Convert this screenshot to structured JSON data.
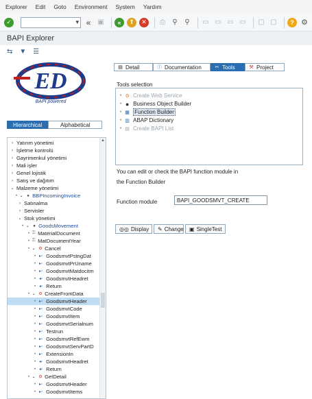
{
  "menu": [
    "Explorer",
    "Edit",
    "Goto",
    "Environment",
    "System",
    "Yardım"
  ],
  "title": "BAPI Explorer",
  "logo_text": "BAPI powered",
  "left_tabs": [
    "Hierarchical",
    "Alphabetical"
  ],
  "tree": [
    {
      "label": "Yatırım yönetimi",
      "indent": 0,
      "icon": "chevron-right-icon",
      "sel": false,
      "blue": false
    },
    {
      "label": "İşletme kontrolü",
      "indent": 0,
      "icon": "chevron-right-icon",
      "sel": false,
      "blue": false
    },
    {
      "label": "Gayrimenkul yönetimi",
      "indent": 0,
      "icon": "chevron-right-icon",
      "sel": false,
      "blue": false
    },
    {
      "label": "Mali işler",
      "indent": 0,
      "icon": "chevron-right-icon",
      "sel": false,
      "blue": false
    },
    {
      "label": "Genel lojistik",
      "indent": 0,
      "icon": "chevron-right-icon",
      "sel": false,
      "blue": false
    },
    {
      "label": "Satış ve dağıtım",
      "indent": 0,
      "icon": "chevron-right-icon",
      "sel": false,
      "blue": false
    },
    {
      "label": "Malzeme yönetimi",
      "indent": 0,
      "icon": "chevron-down-icon",
      "sel": false,
      "blue": false
    },
    {
      "label": "BBPIncomingInvoice",
      "indent": 1,
      "icon": "object-icon",
      "sel": false,
      "blue": true
    },
    {
      "label": "Satınalma",
      "indent": 1,
      "icon": "chevron-right-icon",
      "sel": false,
      "blue": false
    },
    {
      "label": "Servisler",
      "indent": 1,
      "icon": "chevron-right-icon",
      "sel": false,
      "blue": false
    },
    {
      "label": "Stok yönetimi",
      "indent": 1,
      "icon": "chevron-down-icon",
      "sel": false,
      "blue": false
    },
    {
      "label": "GoodsMovement",
      "indent": 2,
      "icon": "object-icon",
      "sel": false,
      "blue": true
    },
    {
      "label": "MaterialDocument",
      "indent": 3,
      "icon": "key-icon",
      "sel": false,
      "blue": false
    },
    {
      "label": "MatDocumentYear",
      "indent": 3,
      "icon": "key-icon",
      "sel": false,
      "blue": false
    },
    {
      "label": "Cancel",
      "indent": 3,
      "icon": "method-icon",
      "sel": false,
      "blue": false
    },
    {
      "label": "GoodsmvtPstngDat",
      "indent": 4,
      "icon": "param-in-icon",
      "sel": false,
      "blue": false
    },
    {
      "label": "GoodsmvtPrUname",
      "indent": 4,
      "icon": "param-in-icon",
      "sel": false,
      "blue": false
    },
    {
      "label": "GoodsmvtMatdocitm",
      "indent": 4,
      "icon": "param-in-icon",
      "sel": false,
      "blue": false
    },
    {
      "label": "GoodsmvtHeadret",
      "indent": 4,
      "icon": "param-out-icon",
      "sel": false,
      "blue": false
    },
    {
      "label": "Return",
      "indent": 4,
      "icon": "param-out-icon",
      "sel": false,
      "blue": false
    },
    {
      "label": "CreateFromData",
      "indent": 3,
      "icon": "method-icon",
      "sel": false,
      "blue": false
    },
    {
      "label": "GoodsmvtHeader",
      "indent": 4,
      "icon": "param-in-icon",
      "sel": true,
      "blue": false
    },
    {
      "label": "GoodsmvtCode",
      "indent": 4,
      "icon": "param-in-icon",
      "sel": false,
      "blue": false
    },
    {
      "label": "GoodsmvtItem",
      "indent": 4,
      "icon": "param-in-icon",
      "sel": false,
      "blue": false
    },
    {
      "label": "GoodsmvtSerialnum",
      "indent": 4,
      "icon": "param-in-icon",
      "sel": false,
      "blue": false
    },
    {
      "label": "Testrun",
      "indent": 4,
      "icon": "param-in-icon",
      "sel": false,
      "blue": false
    },
    {
      "label": "GoodsmvtRefEwm",
      "indent": 4,
      "icon": "param-in-icon",
      "sel": false,
      "blue": false
    },
    {
      "label": "GoodsmvtServPartD",
      "indent": 4,
      "icon": "param-in-icon",
      "sel": false,
      "blue": false
    },
    {
      "label": "ExtensionIn",
      "indent": 4,
      "icon": "param-in-icon",
      "sel": false,
      "blue": false
    },
    {
      "label": "GoodsmvtHeadret",
      "indent": 4,
      "icon": "param-out-icon",
      "sel": false,
      "blue": false
    },
    {
      "label": "Return",
      "indent": 4,
      "icon": "param-out-icon",
      "sel": false,
      "blue": false
    },
    {
      "label": "GetDetail",
      "indent": 3,
      "icon": "method-icon",
      "sel": false,
      "blue": false
    },
    {
      "label": "GoodsmvtHeader",
      "indent": 4,
      "icon": "param-in-icon",
      "sel": false,
      "blue": false
    },
    {
      "label": "GoodsmvtItems",
      "indent": 4,
      "icon": "param-in-icon",
      "sel": false,
      "blue": false
    }
  ],
  "right_tabs": [
    "Detail",
    "Documentation",
    "Tools",
    "Project"
  ],
  "tools_label": "Tools selection",
  "tools": [
    {
      "label": "Create Web Service",
      "icon": "web-service-icon",
      "disabled": true,
      "sel": false
    },
    {
      "label": "Business Object Builder",
      "icon": "object-icon",
      "disabled": false,
      "sel": false
    },
    {
      "label": "Function Builder",
      "icon": "function-builder-icon",
      "disabled": false,
      "sel": true
    },
    {
      "label": "ABAP Dictionary",
      "icon": "dictionary-icon",
      "disabled": false,
      "sel": false
    },
    {
      "label": "Create BAPI List",
      "icon": "list-icon",
      "disabled": true,
      "sel": false
    }
  ],
  "desc1": "You can edit or check the BAPI function module in",
  "desc2": "the Function Builder",
  "fm_label": "Function module",
  "fm_value": "BAPI_GOODSMVT_CREATE",
  "buttons": [
    "Display",
    "Change",
    "SingleTest"
  ]
}
